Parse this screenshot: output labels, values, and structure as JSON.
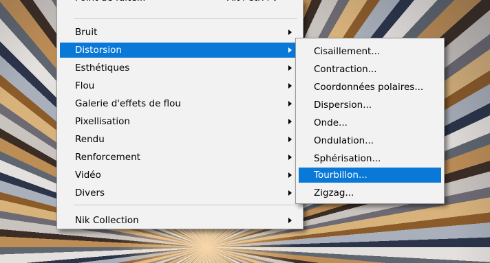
{
  "top_partial": {
    "label": "Point de fuite...",
    "shortcut": "Alt+Ctrl+V"
  },
  "menu": {
    "items": [
      {
        "label": "Bruit"
      },
      {
        "label": "Distorsion"
      },
      {
        "label": "Esthétiques"
      },
      {
        "label": "Flou"
      },
      {
        "label": "Galerie d'effets de flou"
      },
      {
        "label": "Pixellisation"
      },
      {
        "label": "Rendu"
      },
      {
        "label": "Renforcement"
      },
      {
        "label": "Vidéo"
      },
      {
        "label": "Divers"
      }
    ],
    "bottom_item": {
      "label": "Nik Collection"
    }
  },
  "submenu": {
    "items": [
      {
        "label": "Cisaillement..."
      },
      {
        "label": "Contraction..."
      },
      {
        "label": "Coordonnées polaires..."
      },
      {
        "label": "Dispersion..."
      },
      {
        "label": "Onde..."
      },
      {
        "label": "Ondulation..."
      },
      {
        "label": "Sphérisation..."
      },
      {
        "label": "Tourbillon..."
      },
      {
        "label": "Zigzag..."
      }
    ]
  },
  "colors": {
    "menu_bg": "#f2f2f2",
    "highlight": "#0a78d7",
    "text": "#000000",
    "highlight_text": "#ffffff",
    "separator": "#c8c8c8"
  }
}
